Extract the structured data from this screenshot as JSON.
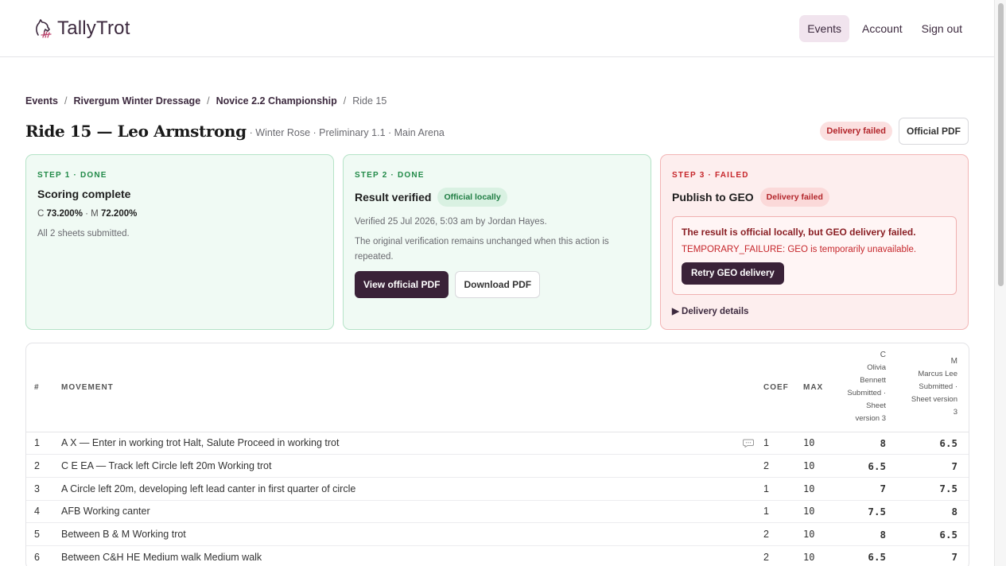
{
  "app": {
    "name": "TallyTrot"
  },
  "nav": {
    "items": [
      "Events",
      "Account",
      "Sign out"
    ],
    "active": "Events"
  },
  "breadcrumb": {
    "items": [
      "Events",
      "Rivergum Winter Dressage",
      "Novice 2.2 Championship"
    ],
    "current": "Ride 15"
  },
  "ride": {
    "title": "Ride 15 — Leo Armstrong",
    "subtitle": "· Winter Rose · Preliminary 1.1 · Main Arena",
    "status_badge": "Delivery failed",
    "official_pdf_label": "Official PDF"
  },
  "steps": [
    {
      "label": "STEP 1 · DONE",
      "title": "Scoring complete",
      "score_c_label": "C",
      "score_c": "73.200%",
      "score_sep": "· M",
      "score_m": "72.200%",
      "note": "All 2 sheets submitted."
    },
    {
      "label": "STEP 2 · DONE",
      "title": "Result verified",
      "badge": "Official locally",
      "verified_text": "Verified 25 Jul 2026, 5:03 am by Jordan Hayes.",
      "note": "The original verification remains unchanged when this action is repeated.",
      "view_pdf_label": "View official PDF",
      "download_pdf_label": "Download PDF"
    },
    {
      "label": "STEP 3 · FAILED",
      "title": "Publish to GEO",
      "badge": "Delivery failed",
      "alert_title": "The result is official locally, but GEO delivery failed.",
      "alert_message": "TEMPORARY_FAILURE: GEO is temporarily unavailable.",
      "retry_label": "Retry GEO delivery",
      "details_label": "▶ Delivery details"
    }
  ],
  "table": {
    "columns": {
      "num": "#",
      "movement": "MOVEMENT",
      "coef": "COEF",
      "max": "MAX",
      "judge_c": {
        "letter": "C",
        "line1": "Olivia",
        "line2": "Bennett",
        "line3": "Submitted ·",
        "line4": "Sheet",
        "line5": "version 3"
      },
      "judge_m": {
        "letter": "M",
        "line1": "Marcus Lee",
        "line2": "Submitted ·",
        "line3": "Sheet version",
        "line4": "3"
      }
    },
    "rows": [
      {
        "num": "1",
        "movement": "A X — Enter in working trot Halt, Salute Proceed in working trot",
        "comment_icon": "comment-icon",
        "coef": "1",
        "max": "10",
        "c": "8",
        "m": "6.5"
      },
      {
        "num": "2",
        "movement": "C E EA — Track left Circle left 20m Working trot",
        "coef": "2",
        "max": "10",
        "c": "6.5",
        "m": "7"
      },
      {
        "num": "3",
        "movement": "A Circle left 20m, developing left lead canter in first quarter of circle",
        "coef": "1",
        "max": "10",
        "c": "7",
        "m": "7.5"
      },
      {
        "num": "4",
        "movement": "AFB Working canter",
        "coef": "1",
        "max": "10",
        "c": "7.5",
        "m": "8"
      },
      {
        "num": "5",
        "movement": "Between B & M Working trot",
        "coef": "2",
        "max": "10",
        "c": "8",
        "m": "6.5"
      },
      {
        "num": "6",
        "movement": "Between C&H HE Medium walk Medium walk",
        "coef": "2",
        "max": "10",
        "c": "6.5",
        "m": "7"
      }
    ]
  },
  "colors": {
    "brand": "#3a2238",
    "success": "#218a48",
    "danger": "#c6262b"
  }
}
